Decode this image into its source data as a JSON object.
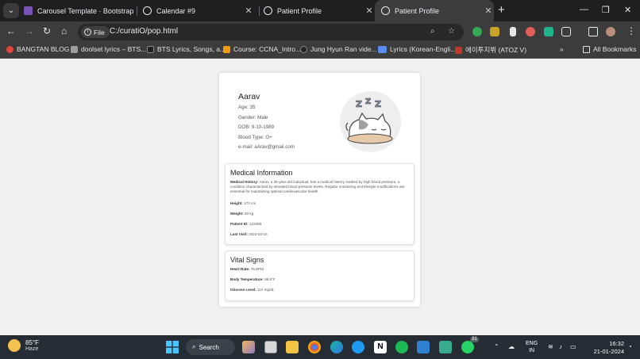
{
  "browser": {
    "tabs": [
      {
        "title": "Carousel Template · Bootstrap v",
        "favicon_color": "#7952b3",
        "active": false
      },
      {
        "title": "Calendar #9",
        "favicon_color": "#ffffff",
        "active": false
      },
      {
        "title": "Patient Profile",
        "favicon_color": "#ffffff",
        "active": false
      },
      {
        "title": "Patient Profile",
        "favicon_color": "#ffffff",
        "active": true
      }
    ],
    "url_chip": "File",
    "url": "C:/curatiO/pop.html",
    "bookmarks": [
      {
        "label": "BANGTAN BLOG",
        "color": "#e0463b"
      },
      {
        "label": "doolset lyrics – BTS...",
        "color": "#9e9e9e"
      },
      {
        "label": "BTS Lyrics, Songs, a...",
        "color": "#222222"
      },
      {
        "label": "Course: CCNA_Intro...",
        "color": "#f39c12"
      },
      {
        "label": "Jung Hyun Ran vide...",
        "color": "#222222"
      },
      {
        "label": "Lyrics (Korean-Engli...",
        "color": "#5b8def"
      },
      {
        "label": "에이투지뷔 (ATOZ V)",
        "color": "#c0392b"
      }
    ],
    "all_bookmarks": "All Bookmarks"
  },
  "profile": {
    "name": "Aarav",
    "age": "Age: 35",
    "gender": "Gender: Male",
    "dob": "DOB: 9-10-1989",
    "blood": "Blood Type: O+",
    "email": "e-mail: aArav@gmail.com"
  },
  "medical": {
    "title": "Medical Information",
    "history_label": "Medical History:",
    "history_text": "Aarav, a 35-year-old individual, has a medical history marked by high blood pressure, a condition characterized by elevated blood pressure levels. Regular monitoring and lifestyle modifications are essential for maintaining optimal cardiovascular health.",
    "height_label": "Height:",
    "height": "170 cm",
    "weight_label": "Weight:",
    "weight": "60 kg",
    "patient_id_label": "Patient ID:",
    "patient_id": "123456",
    "last_visit_label": "Last Visit:",
    "last_visit": "2022-03-15"
  },
  "vitals": {
    "title": "Vital Signs",
    "heart_label": "Heart Rate:",
    "heart": "75 BPM",
    "temp_label": "Body Temperature:",
    "temp": "98.6°F",
    "glucose_label": "Glucose Level:",
    "glucose": "110 mg/dL"
  },
  "taskbar": {
    "temperature": "85°F",
    "condition": "Haze",
    "search": "Search",
    "lang_line1": "ENG",
    "lang_line2": "IN",
    "time": "16:32",
    "date": "21-01-2024",
    "badge_31": "31"
  }
}
